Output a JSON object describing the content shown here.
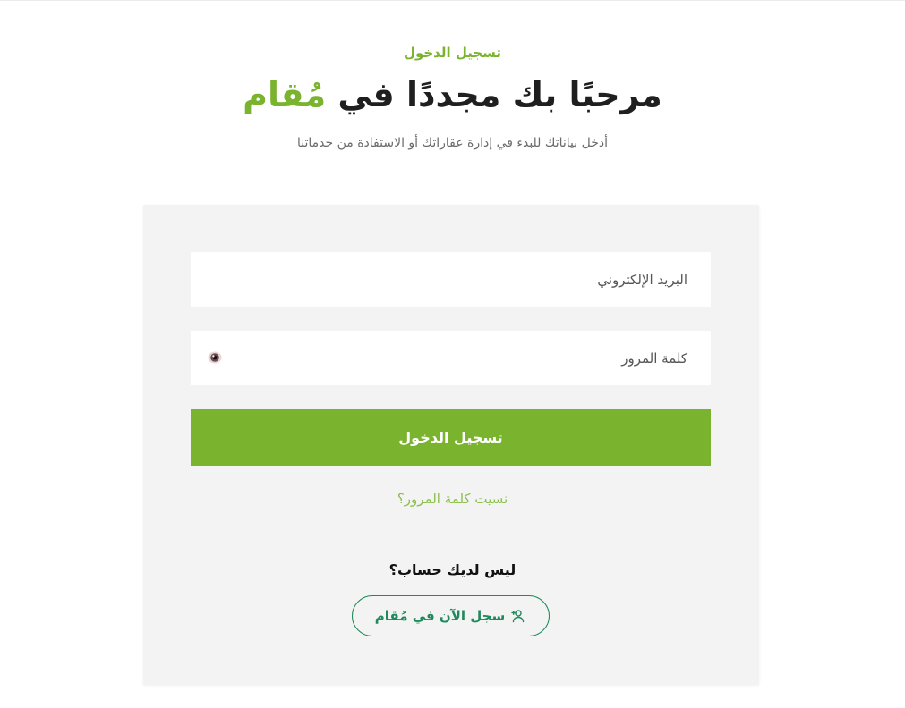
{
  "header": {
    "eyebrow": "تسجيل الدخول",
    "headline_prefix": "مرحبًا بك مجددًا في",
    "brand": "مُقام",
    "subtitle": "أدخل بياناتك للبدء في إدارة عقاراتك أو الاستفادة من خدماتنا"
  },
  "form": {
    "email_placeholder": "البريد الإلكتروني",
    "password_placeholder": "كلمة المرور",
    "password_toggle_icon": "eye-icon",
    "submit_label": "تسجيل الدخول",
    "forgot_label": "نسيت كلمة المرور؟"
  },
  "signup": {
    "prompt": "ليس لديك حساب؟",
    "button_label": "سجل الآن في مُقام",
    "button_icon": "user-plus-icon"
  },
  "colors": {
    "accent": "#7ab32e",
    "secondary": "#1f8a5b",
    "card_bg": "#f3f3f3"
  }
}
